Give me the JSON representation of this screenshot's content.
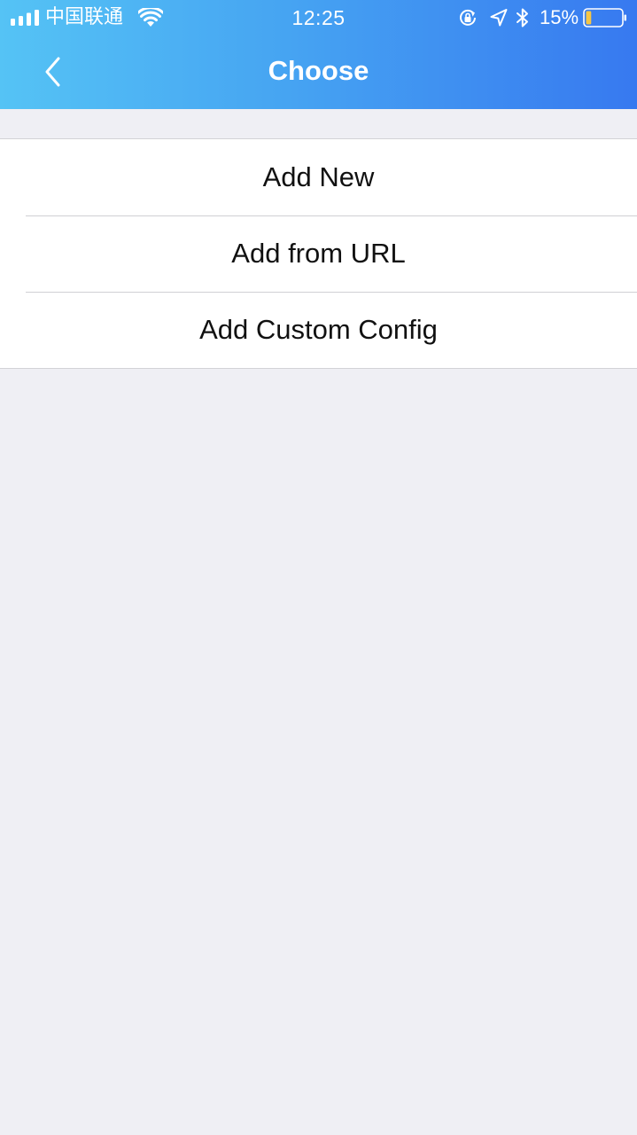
{
  "status_bar": {
    "carrier": "中国联通",
    "time": "12:25",
    "battery_percent": "15%",
    "battery_level": 0.15,
    "signal_icon": "signal-bars-icon",
    "wifi_icon": "wifi-icon",
    "rotation_lock_icon": "rotation-lock-icon",
    "location_icon": "location-arrow-icon",
    "bluetooth_icon": "bluetooth-icon",
    "battery_icon": "battery-icon"
  },
  "navbar": {
    "title": "Choose",
    "back_icon": "chevron-left-icon",
    "gradient_start": "#55c3f5",
    "gradient_end": "#3779f0"
  },
  "menu": {
    "items": [
      {
        "label": "Add New"
      },
      {
        "label": "Add from URL"
      },
      {
        "label": "Add Custom Config"
      }
    ]
  },
  "colors": {
    "background": "#efeff4",
    "battery_fill": "#f5c645",
    "text": "#111111"
  }
}
